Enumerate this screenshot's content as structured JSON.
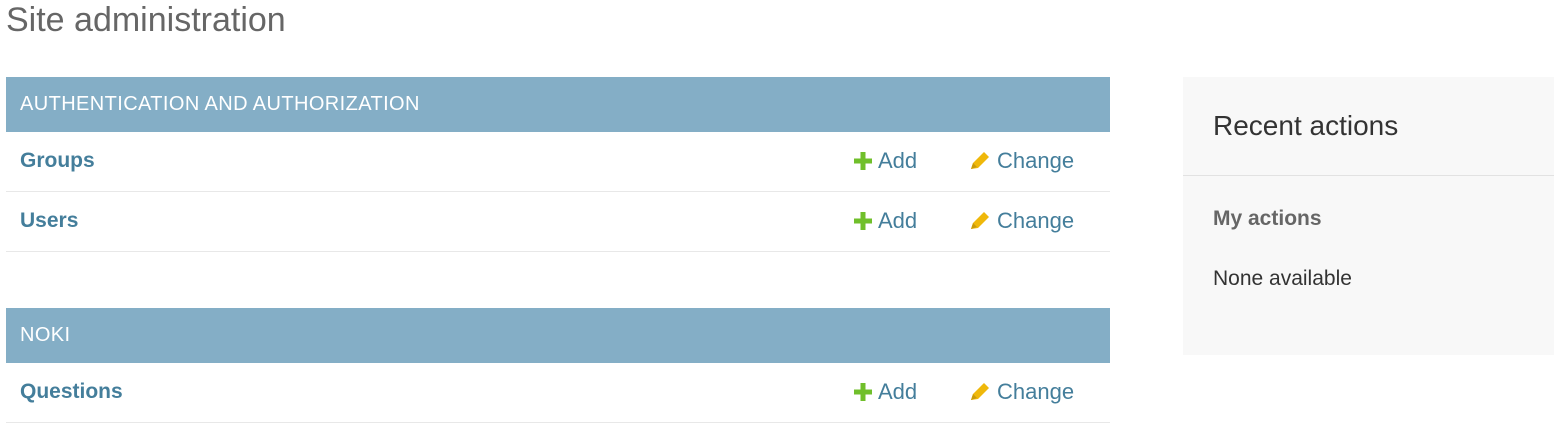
{
  "page": {
    "title": "Site administration"
  },
  "apps": [
    {
      "caption": "AUTHENTICATION AND AUTHORIZATION",
      "models": [
        {
          "name": "Groups",
          "add_label": "Add",
          "change_label": "Change"
        },
        {
          "name": "Users",
          "add_label": "Add",
          "change_label": "Change"
        }
      ]
    },
    {
      "caption": "NOKI",
      "models": [
        {
          "name": "Questions",
          "add_label": "Add",
          "change_label": "Change"
        }
      ]
    }
  ],
  "recent": {
    "title": "Recent actions",
    "subtitle": "My actions",
    "empty_text": "None available"
  },
  "icons": {
    "add": "plus-icon",
    "change": "pencil-icon"
  },
  "colors": {
    "caption_bg": "#84aec6",
    "link": "#447e9b",
    "add_icon": "#70bf2b",
    "change_icon": "#efb80b",
    "sidebar_bg": "#f8f8f8"
  }
}
